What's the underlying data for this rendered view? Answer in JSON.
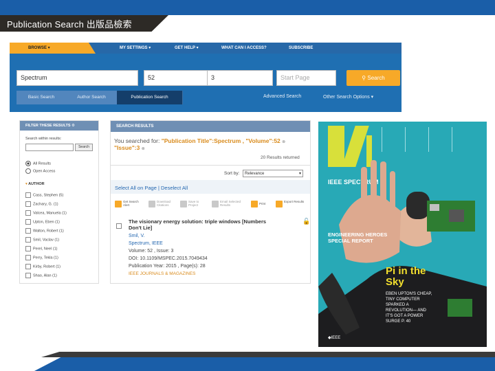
{
  "slide": {
    "title": "Publication Search 出版品檢索"
  },
  "nav": {
    "browse": "BROWSE",
    "my_settings": "MY SETTINGS",
    "get_help": "GET HELP",
    "what_can_i_access": "WHAT CAN I ACCESS?",
    "subscribe": "SUBSCRIBE"
  },
  "search": {
    "title_value": "Spectrum",
    "volume_value": "52",
    "issue_value": "3",
    "start_page_placeholder": "Start Page",
    "button_label": "Search"
  },
  "tabs": [
    "Basic Search",
    "Author Search",
    "Publication Search"
  ],
  "advanced_search": "Advanced Search",
  "other_options": "Other Search Options",
  "filter": {
    "header": "FILTER THESE RESULTS",
    "search_within_label": "Search within results:",
    "search_button": "Search",
    "radios": [
      "All Results",
      "Open Access"
    ],
    "author_header": "AUTHOR",
    "authors": [
      "Cass, Stephen (5)",
      "Zachary, G. (1)",
      "Valcea, Manuela (1)",
      "Upton, Eben (1)",
      "Walton, Robert (1)",
      "Smil, Vaclav (1)",
      "Perel, Neel (1)",
      "Perry, Tekla (1)",
      "Kirby, Robert (1)",
      "Shao, Alan (1)"
    ]
  },
  "results": {
    "header": "SEARCH RESULTS",
    "searched_for_prefix": "You searched for:",
    "query_text": "\"Publication Title\":Spectrum , \"Volume\":52",
    "query_issue": "\"Issue\":3",
    "count": "20 Results returned",
    "sort_label": "Sort by:",
    "sort_value": "Relevance",
    "select_all": "Select All on Page | Deselect All",
    "actions": [
      "Get Search Alert",
      "Download Citations",
      "Save to Project",
      "Email Selected Results",
      "Print",
      "Export Results"
    ],
    "item": {
      "title": "The visionary energy solution: triple windows [Numbers Don't Lie]",
      "author": "Smil, V.",
      "publication": "Spectrum, IEEE",
      "volume_issue": "Volume: 52 , Issue: 3",
      "doi": "DOI: 10.1109/MSPEC.2015.7049434",
      "year_pages": "Publication Year: 2015 , Page(s): 28",
      "source": "IEEE JOURNALS & MAGAZINES"
    }
  },
  "cover": {
    "brand": "IEEE SPECTRUM",
    "feature": "ENGINEERING HEROES SPECIAL REPORT",
    "headline": "Pi in the Sky",
    "subhead": "EBEN UPTON'S CHEAP, TINY COMPUTER SPARKED A REVOLUTION— AND IT'S GOT A POWER SURGE P. 40",
    "footer": "IEEE"
  },
  "colors": {
    "nav_blue": "#1f6fb2",
    "accent_orange": "#f7a928",
    "cover_teal": "#28a9b6",
    "cover_logo_yellow": "#d8e03a"
  }
}
